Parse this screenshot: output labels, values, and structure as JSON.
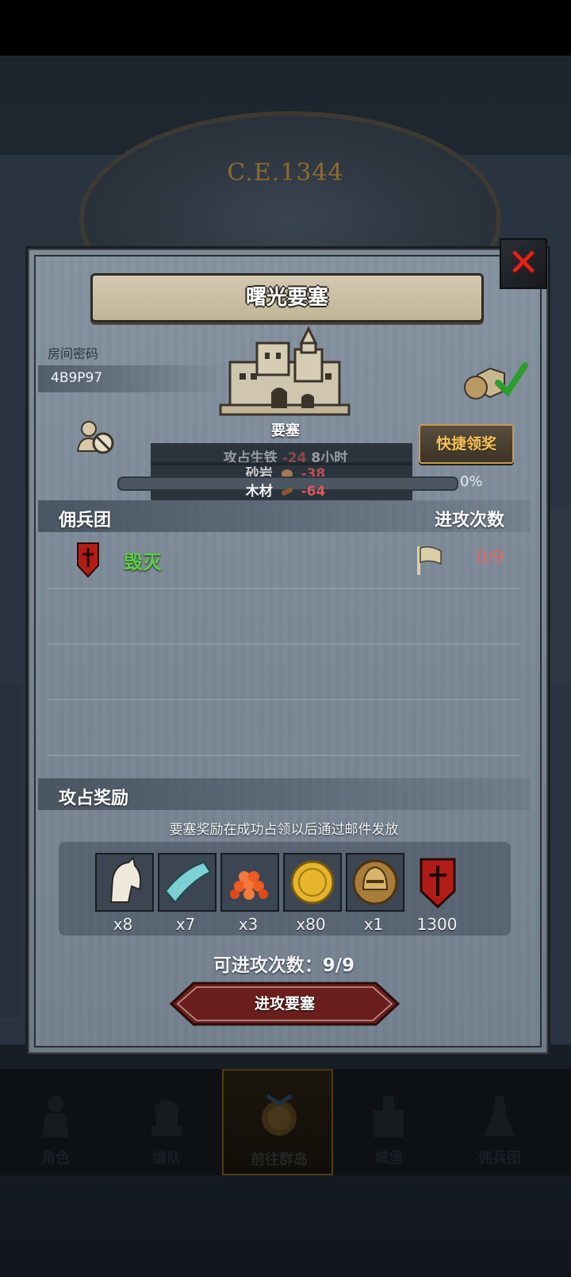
{
  "background": {
    "era_text": "C.E.1344"
  },
  "dialog": {
    "title": "曙光要塞",
    "room": {
      "label": "房间密码",
      "code": "4B9P97"
    },
    "fortress_name": "要塞",
    "quick_claim_label": "快捷领奖",
    "resources": {
      "row1": {
        "label": "攻占生铁",
        "value": "-24",
        "suffix": "8小时"
      },
      "row2": {
        "label": "砂岩",
        "value": "-38"
      },
      "row3": {
        "label": "木材",
        "value": "-64"
      }
    },
    "progress": {
      "percent_text": "0%",
      "value": 0
    },
    "mercenary_section": {
      "title": "佣兵团",
      "right_title": "进攻次数"
    },
    "mercenary_rows": [
      {
        "name": "毁灭",
        "count": "0/9"
      }
    ],
    "reward_section": {
      "title": "攻占奖励",
      "note": "要塞奖励在成功占领以后通过邮件发放",
      "items": [
        {
          "icon": "horse-icon",
          "qty": "x8"
        },
        {
          "icon": "cloth-icon",
          "qty": "x7"
        },
        {
          "icon": "red-beads-icon",
          "qty": "x3"
        },
        {
          "icon": "gold-coin-icon",
          "qty": "x80"
        },
        {
          "icon": "knight-helmet-icon",
          "qty": "x1"
        },
        {
          "icon": "mercenary-banner-icon",
          "qty": "1300"
        }
      ]
    },
    "attacks_left": "可进攻次数：9/9",
    "attack_button": "进攻要塞"
  },
  "nav": {
    "items": [
      {
        "label": "角色",
        "icon": "character-icon"
      },
      {
        "label": "编队",
        "icon": "formation-icon"
      },
      {
        "label": "前往群岛",
        "icon": "archipelago-icon",
        "active": true
      },
      {
        "label": "城堡",
        "icon": "castle-icon"
      },
      {
        "label": "佣兵团",
        "icon": "mercenary-icon"
      }
    ]
  },
  "colors": {
    "accent_gold": "#f4c35a",
    "merc_green": "#5fce48",
    "count_red": "#e06868",
    "close_red": "#e0241b"
  }
}
